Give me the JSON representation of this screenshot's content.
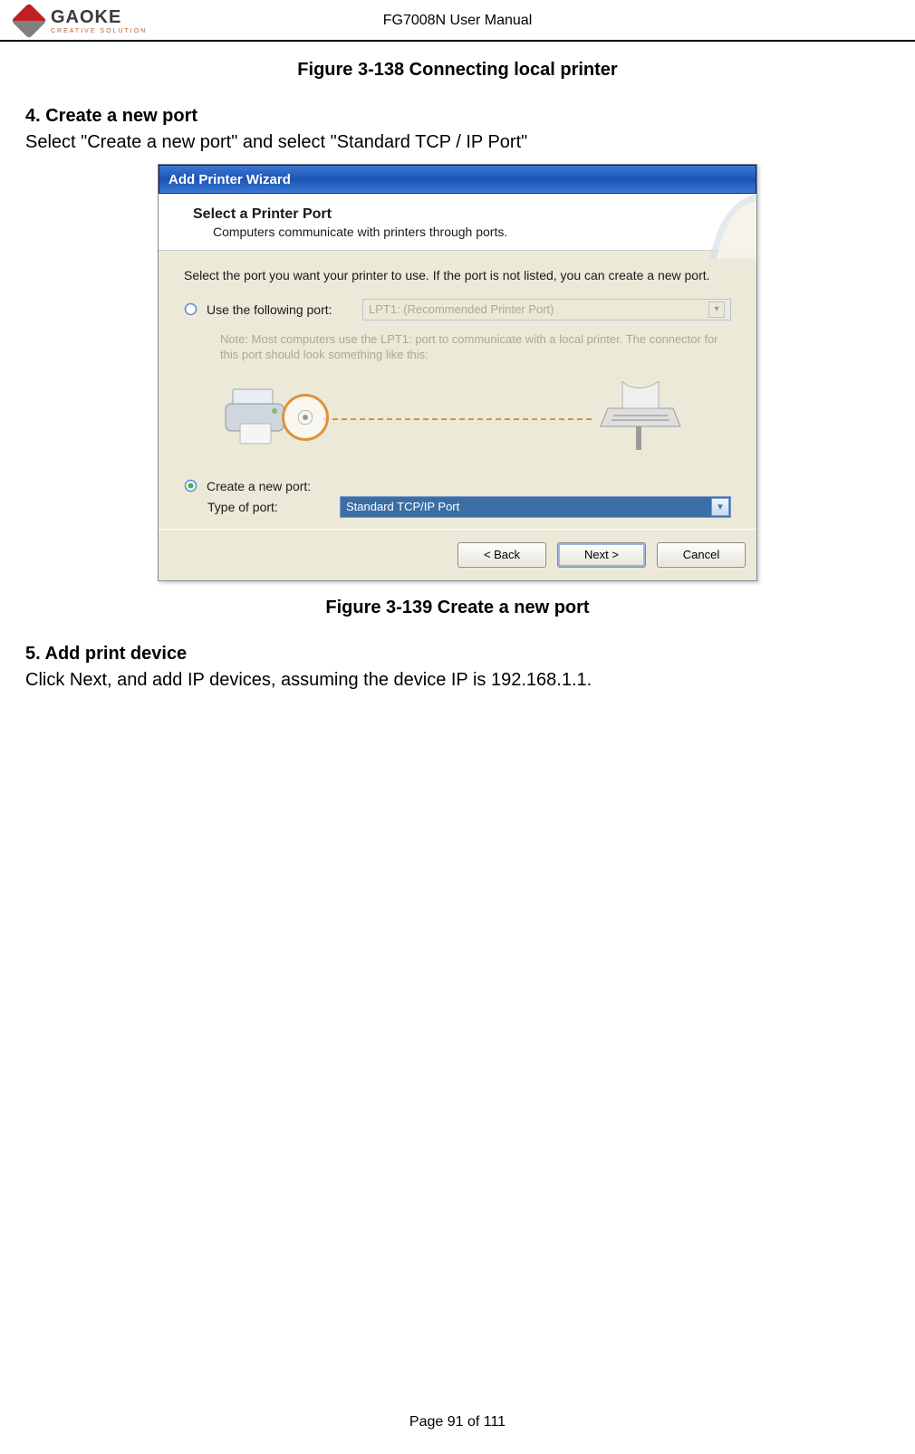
{
  "header": {
    "logo_main": "GAOKE",
    "logo_sub": "CREATIVE SOLUTION",
    "title": "FG7008N User Manual"
  },
  "captions": {
    "fig138": "Figure 3-138  Connecting local printer",
    "fig139": "Figure 3-139  Create a new port"
  },
  "step4": {
    "num_label": "4.    Create a new port",
    "body": "Select \"Create a new port\" and select \"Standard TCP / IP Port\""
  },
  "dialog": {
    "title": "Add Printer Wizard",
    "pane_title": "Select a Printer Port",
    "pane_sub": "Computers communicate with printers through ports.",
    "intro": "Select the port you want your printer to use.  If the port is not listed, you can create a new port.",
    "use_following_label": "Use the following port:",
    "lpt1_text": "LPT1: (Recommended Printer Port)",
    "note": "Note: Most computers use the LPT1: port to communicate with a local printer. The connector for this port should look something like this:",
    "create_label": "Create a new port:",
    "type_label": "Type of port:",
    "type_value": "Standard TCP/IP Port",
    "btn_back": "< Back",
    "btn_next": "Next >",
    "btn_cancel": "Cancel"
  },
  "step5": {
    "num_label": "5.    Add print device",
    "body": "Click Next, and add IP devices, assuming the device IP is 192.168.1.1."
  },
  "footer": {
    "page": "Page 91 of 111"
  }
}
